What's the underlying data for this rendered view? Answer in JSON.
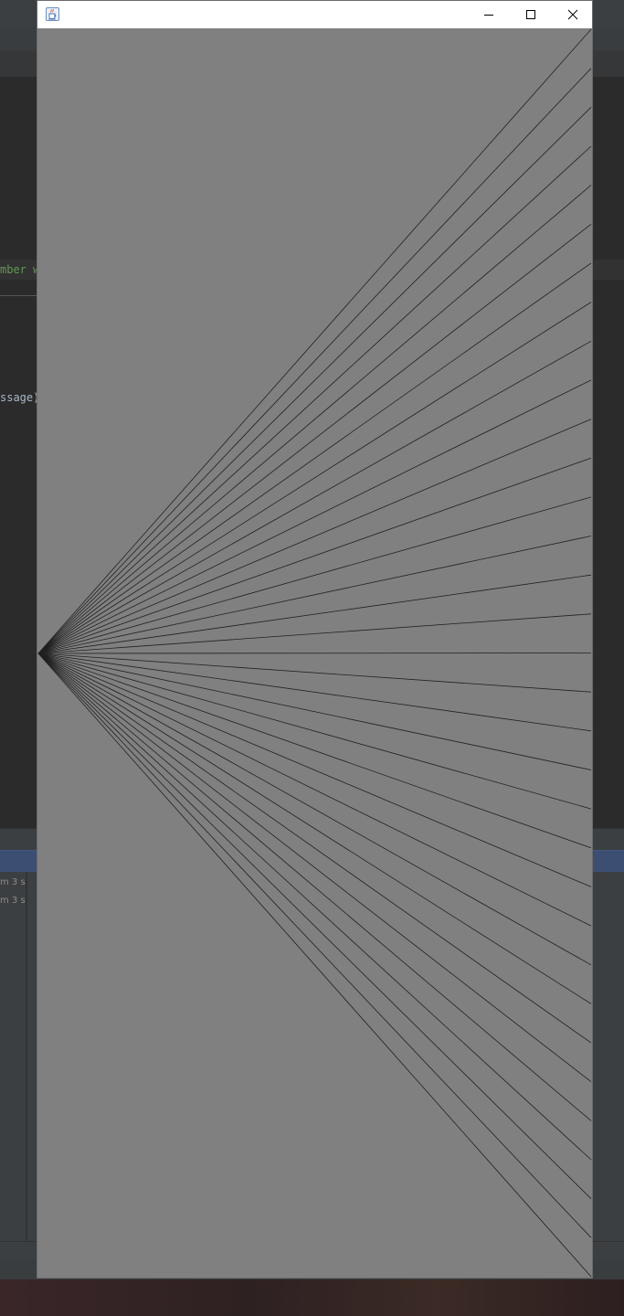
{
  "ide_background": {
    "editor_comment_fragment": "mber wh",
    "editor_call_fragment": "ssage",
    "editor_call_paren": ")",
    "run_times": [
      "m 3 s",
      "m 3 s"
    ]
  },
  "window": {
    "title": "",
    "app_icon": "java-cup-icon",
    "controls": [
      "minimize-icon",
      "maximize-icon",
      "close-icon"
    ]
  },
  "drawing": {
    "description_type": "line fan",
    "line_count": 33,
    "line_color": "#202020",
    "background_color": "#808080"
  },
  "colors": {
    "canvas_bg": "#808080",
    "titlebar_bg": "#ffffff",
    "ide_bg": "#2b2b2b",
    "ide_panel": "#3c3f41",
    "comment_green": "#629755",
    "code_text": "#a9b7c6"
  }
}
